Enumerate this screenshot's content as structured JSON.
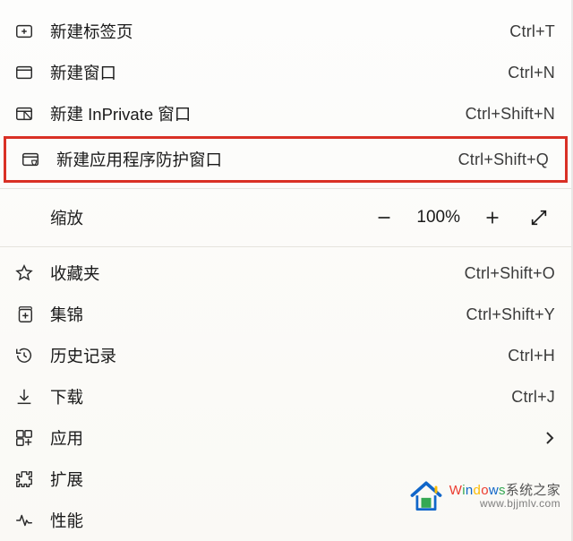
{
  "menu": {
    "items": [
      {
        "icon": "plus-tab-icon",
        "label": "新建标签页",
        "shortcut": "Ctrl+T"
      },
      {
        "icon": "window-icon",
        "label": "新建窗口",
        "shortcut": "Ctrl+N"
      },
      {
        "icon": "inprivate-icon",
        "label": "新建 InPrivate 窗口",
        "shortcut": "Ctrl+Shift+N"
      },
      {
        "icon": "guard-icon",
        "label": "新建应用程序防护窗口",
        "shortcut": "Ctrl+Shift+Q",
        "highlight": true
      }
    ],
    "zoom": {
      "label": "缩放",
      "value": "100%"
    },
    "items2": [
      {
        "icon": "star-icon",
        "label": "收藏夹",
        "shortcut": "Ctrl+Shift+O"
      },
      {
        "icon": "collections-icon",
        "label": "集锦",
        "shortcut": "Ctrl+Shift+Y"
      },
      {
        "icon": "history-icon",
        "label": "历史记录",
        "shortcut": "Ctrl+H"
      },
      {
        "icon": "download-icon",
        "label": "下载",
        "shortcut": "Ctrl+J"
      },
      {
        "icon": "apps-icon",
        "label": "应用",
        "arrow": true
      },
      {
        "icon": "extensions-icon",
        "label": "扩展"
      },
      {
        "icon": "performance-icon",
        "label": "性能"
      }
    ]
  },
  "brand": {
    "name_colored": [
      "W",
      "i",
      "n",
      "d",
      "o",
      "w",
      "s"
    ],
    "suffix": "系统之家",
    "url": "www.bjjmlv.com"
  }
}
